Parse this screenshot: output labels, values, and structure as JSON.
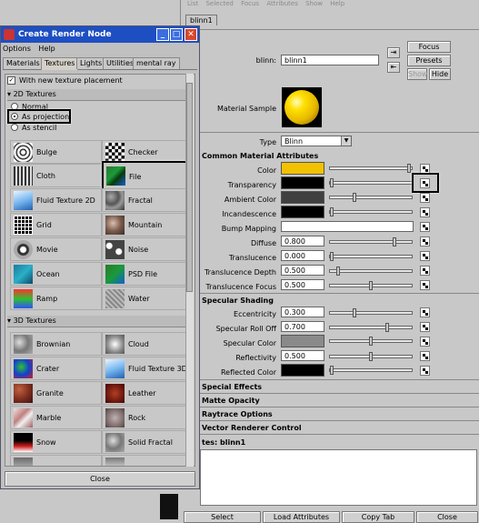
{
  "attribute_editor": {
    "menubar": [
      "List",
      "Selected",
      "Focus",
      "Attributes",
      "Show",
      "Help"
    ],
    "tab": "blinn1",
    "node_label": "blinn:",
    "node_value": "blinn1",
    "buttons": {
      "focus": "Focus",
      "presets": "Presets",
      "show": "Show",
      "hide": "Hide"
    },
    "material_sample_label": "Material Sample",
    "type_label": "Type",
    "type_value": "Blinn",
    "sections": {
      "common": "Common Material Attributes",
      "specular": "Specular Shading",
      "special_effects": "Special Effects",
      "matte_opacity": "Matte Opacity",
      "raytrace": "Raytrace Options",
      "vector": "Vector Renderer Control"
    },
    "attrs": {
      "color": "Color",
      "transparency": "Transparency",
      "ambient": "Ambient Color",
      "incandescence": "Incandescence",
      "bump": "Bump Mapping",
      "diffuse": "Diffuse",
      "diffuse_val": "0.800",
      "translucence": "Translucence",
      "translucence_val": "0.000",
      "trans_depth": "Translucence Depth",
      "trans_depth_val": "0.500",
      "trans_focus": "Translucence Focus",
      "trans_focus_val": "0.500",
      "eccentricity": "Eccentricity",
      "eccentricity_val": "0.300",
      "spec_rolloff": "Specular Roll Off",
      "spec_rolloff_val": "0.700",
      "spec_color": "Specular Color",
      "reflectivity": "Reflectivity",
      "reflectivity_val": "0.500",
      "reflected_color": "Reflected Color"
    },
    "notes_label": "tes:  blinn1",
    "bottom": {
      "select": "Select",
      "load": "Load Attributes",
      "copy": "Copy Tab",
      "close": "Close"
    },
    "colors": {
      "color_swatch": "#f2c200",
      "dark_swatch": "#000000",
      "ambient_swatch": "#404040",
      "spec_swatch": "#8a8a8a"
    }
  },
  "create_render_node": {
    "title": "Create Render Node",
    "menu": [
      "Options",
      "Help"
    ],
    "tabs": [
      "Materials",
      "Textures",
      "Lights",
      "Utilities",
      "mental ray"
    ],
    "active_tab": "Textures",
    "checkbox_label": "With new texture placement",
    "section_2d": "2D Textures",
    "radio": [
      "Normal",
      "As projection",
      "As stencil"
    ],
    "textures_2d": [
      "Bulge",
      "Checker",
      "Cloth",
      "File",
      "Fluid Texture 2D",
      "Fractal",
      "Grid",
      "Mountain",
      "Movie",
      "Noise",
      "Ocean",
      "PSD File",
      "Ramp",
      "Water"
    ],
    "section_3d": "3D Textures",
    "textures_3d": [
      "Brownian",
      "Cloud",
      "Crater",
      "Fluid Texture 3D",
      "Granite",
      "Leather",
      "Marble",
      "Rock",
      "Snow",
      "Solid Fractal"
    ],
    "close": "Close"
  }
}
